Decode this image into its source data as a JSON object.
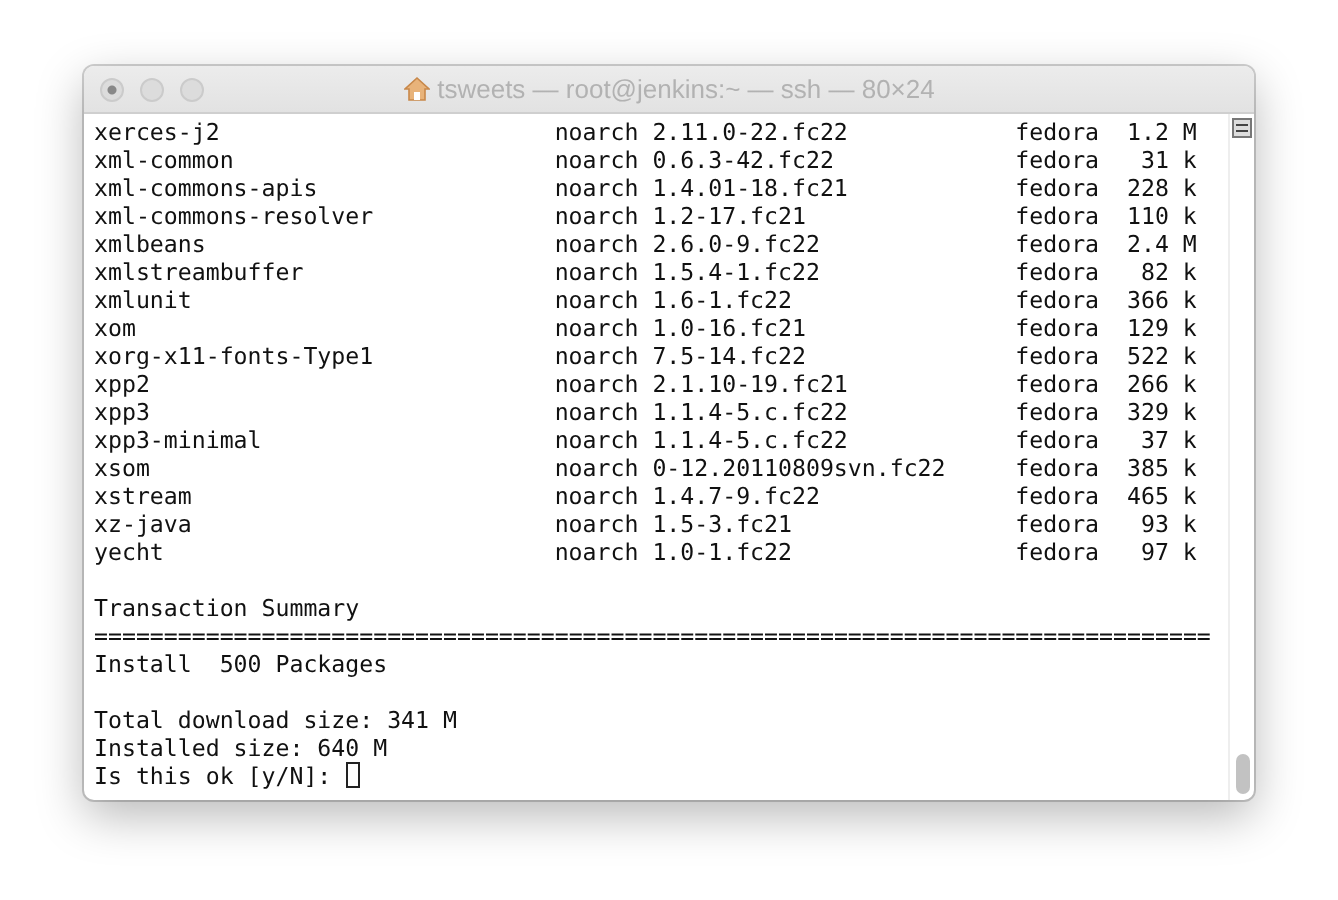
{
  "window": {
    "title": "tsweets — root@jenkins:~ — ssh — 80×24"
  },
  "packages": [
    {
      "name": "xerces-j2",
      "arch": "noarch",
      "version": "2.11.0-22.fc22",
      "repo": "fedora",
      "size": "1.2 M"
    },
    {
      "name": "xml-common",
      "arch": "noarch",
      "version": "0.6.3-42.fc22",
      "repo": "fedora",
      "size": "31 k"
    },
    {
      "name": "xml-commons-apis",
      "arch": "noarch",
      "version": "1.4.01-18.fc21",
      "repo": "fedora",
      "size": "228 k"
    },
    {
      "name": "xml-commons-resolver",
      "arch": "noarch",
      "version": "1.2-17.fc21",
      "repo": "fedora",
      "size": "110 k"
    },
    {
      "name": "xmlbeans",
      "arch": "noarch",
      "version": "2.6.0-9.fc22",
      "repo": "fedora",
      "size": "2.4 M"
    },
    {
      "name": "xmlstreambuffer",
      "arch": "noarch",
      "version": "1.5.4-1.fc22",
      "repo": "fedora",
      "size": "82 k"
    },
    {
      "name": "xmlunit",
      "arch": "noarch",
      "version": "1.6-1.fc22",
      "repo": "fedora",
      "size": "366 k"
    },
    {
      "name": "xom",
      "arch": "noarch",
      "version": "1.0-16.fc21",
      "repo": "fedora",
      "size": "129 k"
    },
    {
      "name": "xorg-x11-fonts-Type1",
      "arch": "noarch",
      "version": "7.5-14.fc22",
      "repo": "fedora",
      "size": "522 k"
    },
    {
      "name": "xpp2",
      "arch": "noarch",
      "version": "2.1.10-19.fc21",
      "repo": "fedora",
      "size": "266 k"
    },
    {
      "name": "xpp3",
      "arch": "noarch",
      "version": "1.1.4-5.c.fc22",
      "repo": "fedora",
      "size": "329 k"
    },
    {
      "name": "xpp3-minimal",
      "arch": "noarch",
      "version": "1.1.4-5.c.fc22",
      "repo": "fedora",
      "size": "37 k"
    },
    {
      "name": "xsom",
      "arch": "noarch",
      "version": "0-12.20110809svn.fc22",
      "repo": "fedora",
      "size": "385 k"
    },
    {
      "name": "xstream",
      "arch": "noarch",
      "version": "1.4.7-9.fc22",
      "repo": "fedora",
      "size": "465 k"
    },
    {
      "name": "xz-java",
      "arch": "noarch",
      "version": "1.5-3.fc21",
      "repo": "fedora",
      "size": "93 k"
    },
    {
      "name": "yecht",
      "arch": "noarch",
      "version": "1.0-1.fc22",
      "repo": "fedora",
      "size": "97 k"
    }
  ],
  "summary": {
    "heading": "Transaction Summary",
    "rule": "================================================================================",
    "install": "Install  500 Packages"
  },
  "totals": [
    "Total download size: 341 M",
    "Installed size: 640 M"
  ],
  "prompt": {
    "text": "Is this ok [y/N]: "
  }
}
